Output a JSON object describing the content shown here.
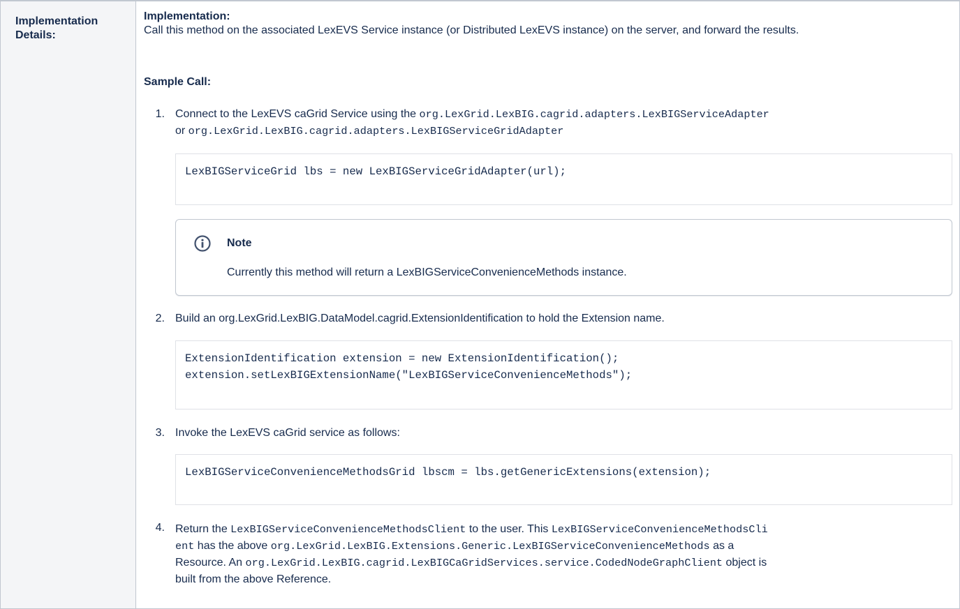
{
  "table": {
    "header_cell": "Implementation Details:"
  },
  "content": {
    "impl_heading": "Implementation:",
    "impl_text": "Call this method on the associated LexEVS Service instance (or Distributed LexEVS instance) on the server, and forward the results.",
    "sample_heading": "Sample Call:",
    "steps": [
      {
        "number": "1.",
        "text_a": "Connect to the LexEVS caGrid Service using the ",
        "code_a": "org.LexGrid.LexBIG.cagrid.adapters.LexBIGServiceAdapter",
        "text_b": "or ",
        "code_b": "org.LexGrid.LexBIG.cagrid.adapters.LexBIGServiceGridAdapter",
        "code_block": [
          "LexBIGServiceGrid lbs = new LexBIGServiceGridAdapter(url);"
        ]
      },
      {
        "number": "2.",
        "text": "Build an org.LexGrid.LexBIG.DataModel.cagrid.ExtensionIdentification to hold the Extension name.",
        "code_block": [
          "ExtensionIdentification extension = new ExtensionIdentification();",
          "extension.setLexBIGExtensionName(\"LexBIGServiceConvenienceMethods\");"
        ]
      },
      {
        "number": "3.",
        "text": "Invoke the LexEVS caGrid service as follows:",
        "code_block": [
          "LexBIGServiceConvenienceMethodsGrid lbscm = lbs.getGenericExtensions(extension);"
        ]
      },
      {
        "number": "4.",
        "t1": "Return the ",
        "c1": "LexBIGServiceConvenienceMethodsClient",
        "t2": " to the user. This ",
        "c2a": "LexBIGServiceConvenienceMethodsCli",
        "c2b": "ent",
        "t3": " has the above ",
        "c3": "org.LexGrid.LexBIG.Extensions.Generic.LexBIGServiceConvenienceMethods",
        "t4": " as a",
        "t5": "Resource. An ",
        "c4": "org.LexGrid.LexBIG.cagrid.LexBIGCaGridServices.service.CodedNodeGraphClient",
        "t6": " object is",
        "t7": "built from the above Reference."
      }
    ],
    "note": {
      "icon": "info-icon",
      "title": "Note",
      "text": "Currently this method will return a LexBIGServiceConvenienceMethods instance."
    }
  },
  "colors": {
    "text": "#172b4d",
    "header_bg": "#f4f5f7",
    "border": "#c1c7d0",
    "info_icon": "#42526e"
  }
}
